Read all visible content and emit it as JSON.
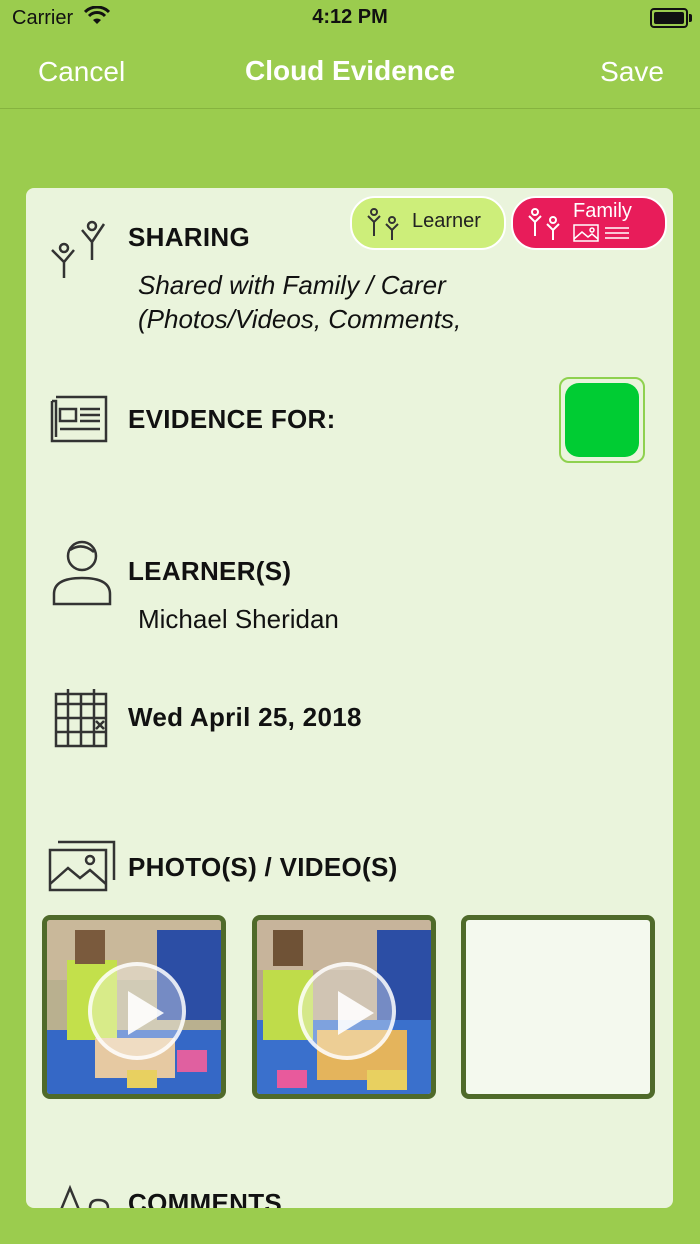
{
  "status_bar": {
    "carrier": "Carrier",
    "time": "4:12 PM"
  },
  "nav": {
    "cancel": "Cancel",
    "title": "Cloud Evidence",
    "save": "Save"
  },
  "sharing": {
    "title": "SHARING",
    "text_line1": "Shared with Family / Carer",
    "text_line2": "(Photos/Videos, Comments,",
    "chip_learner": "Learner",
    "chip_family": "Family"
  },
  "evidence": {
    "title": "EVIDENCE FOR:",
    "color": "#00cc33"
  },
  "learners": {
    "title": "LEARNER(S)",
    "name": "Michael Sheridan"
  },
  "date": {
    "value": "Wed April 25, 2018"
  },
  "media": {
    "title": "PHOTO(S) / VIDEO(S)",
    "items": [
      "video",
      "video",
      "empty"
    ]
  },
  "comments": {
    "title": "COMMENTS"
  },
  "colors": {
    "background": "#9bcc4e",
    "card": "#eaf4dc",
    "learner_chip": "#cdee7a",
    "family_chip": "#e81c5a",
    "thumb_border": "#4f6a2a"
  }
}
